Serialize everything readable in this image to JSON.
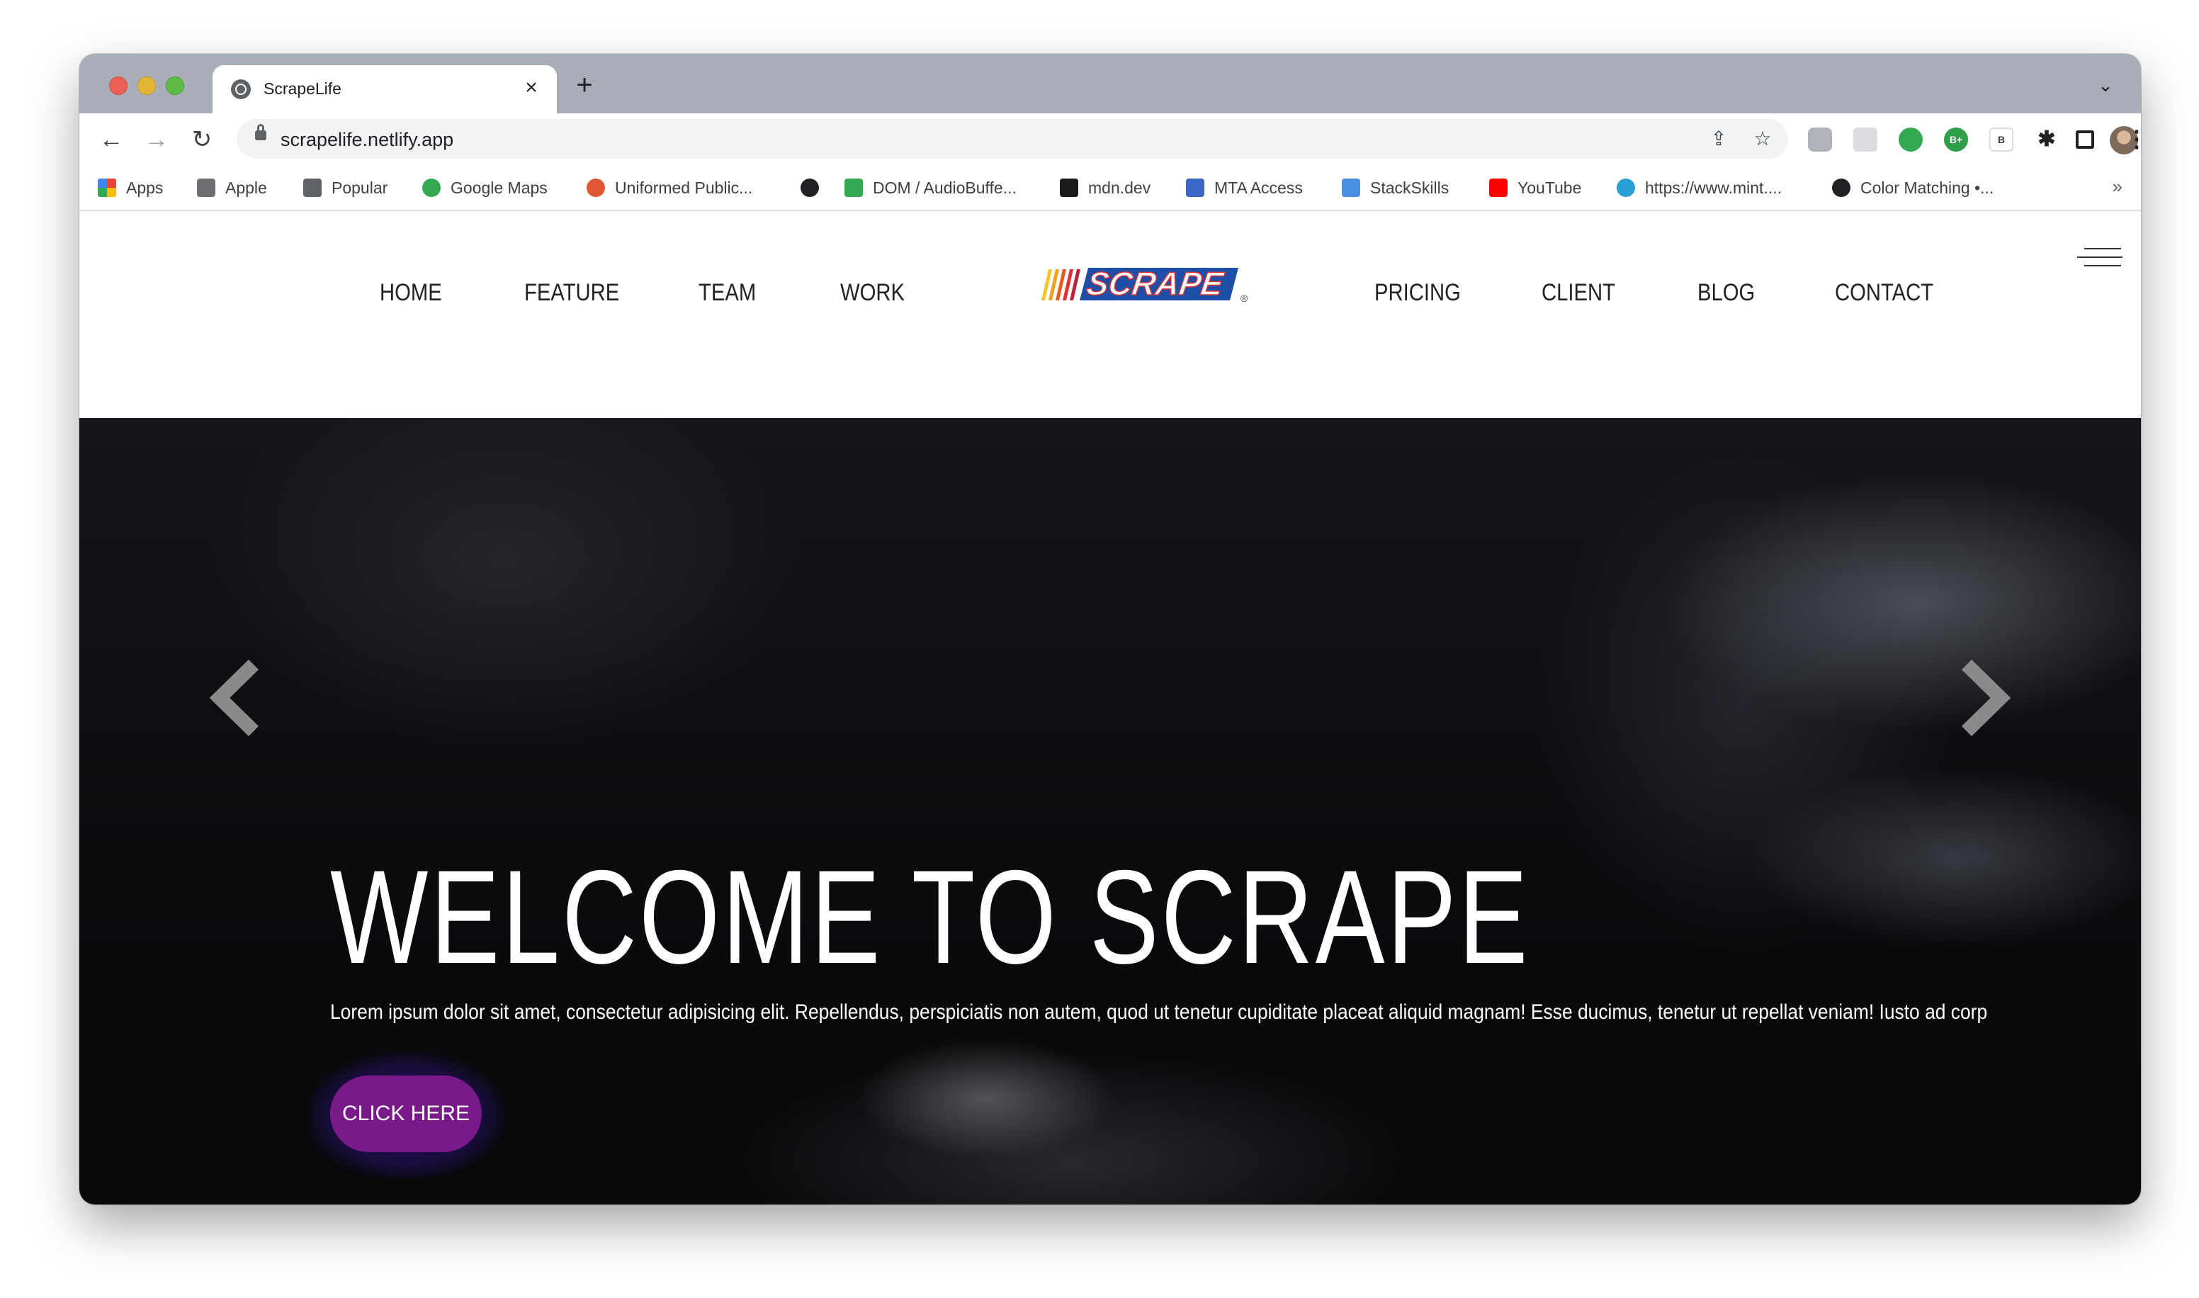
{
  "browser": {
    "tab": {
      "title": "ScrapeLife",
      "close_glyph": "×",
      "favicon": "globe-icon"
    },
    "new_tab_glyph": "+",
    "tab_menu_glyph": "⌄",
    "nav": {
      "back_glyph": "←",
      "forward_glyph": "→",
      "reload_glyph": "↻"
    },
    "url": "scrapelife.netlify.app",
    "omnibox_icons": {
      "share_glyph": "⇪",
      "star_glyph": "☆"
    },
    "extensions": {
      "ext4_label": "B+",
      "ext5_label": "B",
      "puzzle_glyph": "✱"
    },
    "menu_glyph": "⋮",
    "bookmarks": [
      {
        "label": "Apps",
        "icon": "apps-grid-icon",
        "color": "#ea4335"
      },
      {
        "label": "Apple",
        "icon": "apple-icon",
        "color": "#6e6e73"
      },
      {
        "label": "Popular",
        "icon": "folder-icon",
        "color": "#5f6368"
      },
      {
        "label": "Google Maps",
        "icon": "maps-pin-icon",
        "color": "#34a853"
      },
      {
        "label": "Uniformed Public...",
        "icon": "duckduckgo-icon",
        "color": "#de5833"
      },
      {
        "label": "",
        "icon": "globe-icon",
        "color": "#202124"
      },
      {
        "label": "DOM / AudioBuffe...",
        "icon": "doc-icon",
        "color": "#34a853"
      },
      {
        "label": "mdn.dev",
        "icon": "mdn-icon",
        "color": "#1b1b1b"
      },
      {
        "label": "MTA Access",
        "icon": "lock-bag-icon",
        "color": "#3a66c4"
      },
      {
        "label": "StackSkills",
        "icon": "stack-icon",
        "color": "#4a90e2"
      },
      {
        "label": "YouTube",
        "icon": "youtube-icon",
        "color": "#ff0000"
      },
      {
        "label": "https://www.mint....",
        "icon": "drop-icon",
        "color": "#27a0d6"
      },
      {
        "label": "Color Matching •...",
        "icon": "globe-icon",
        "color": "#202124"
      }
    ],
    "bookmarks_more_glyph": "»"
  },
  "site": {
    "nav_left": [
      "HOME",
      "FEATURE",
      "TEAM",
      "WORK"
    ],
    "logo_text": "SCRAPE",
    "logo_mark": "®",
    "nav_right": [
      "PRICING",
      "CLIENT",
      "BLOG",
      "CONTACT"
    ],
    "hero": {
      "title": "WELCOME TO SCRAPE",
      "text": "Lorem ipsum dolor sit amet, consectetur adipisicing elit. Repellendus, perspiciatis non autem, quod ut tenetur cupiditate placeat aliquid magnam! Esse ducimus, tenetur ut repellat veniam! Iusto ad corp",
      "button_label": "CLICK HERE"
    }
  },
  "colors": {
    "accent_button": "#7a1a8a",
    "logo_blue": "#1e4fa8",
    "logo_red": "#e03030",
    "hero_background": "#0b0b0e"
  }
}
